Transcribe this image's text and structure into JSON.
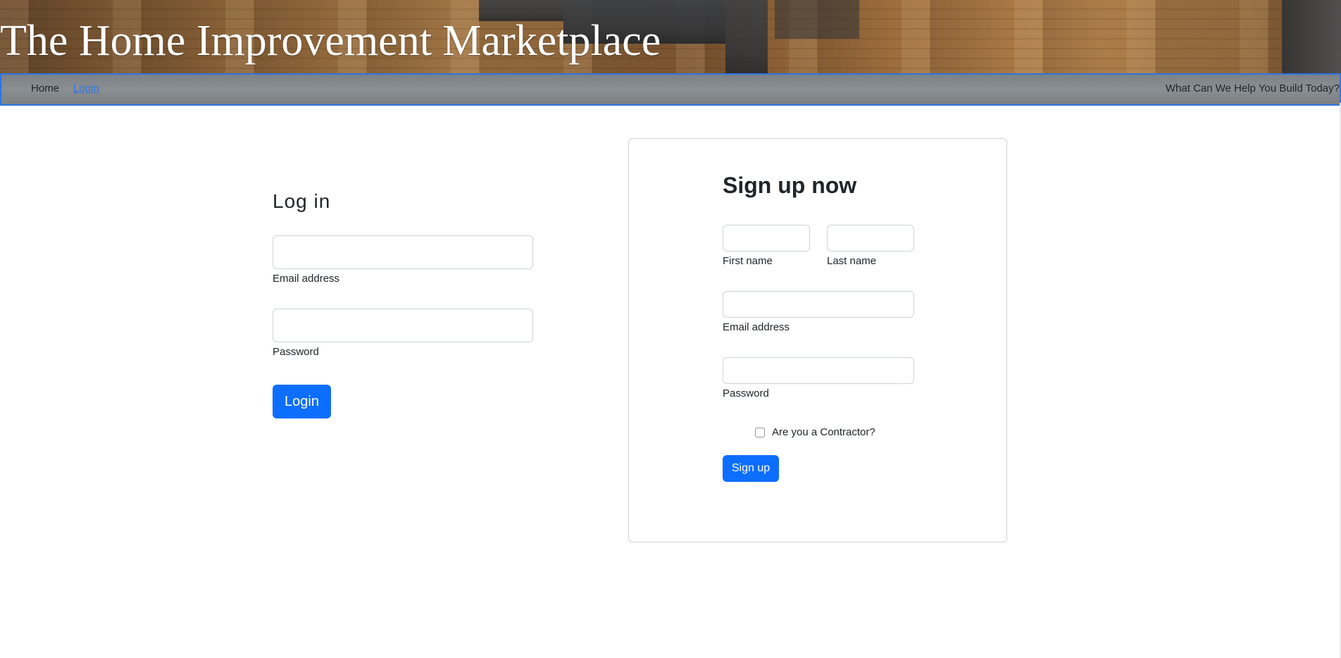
{
  "header": {
    "site_title": "The Home Improvement Marketplace"
  },
  "navbar": {
    "home_label": "Home",
    "login_label": "Login",
    "tagline": "What Can We Help You Build Today?"
  },
  "login": {
    "title": "Log in",
    "email_label": "Email address",
    "email_value": "",
    "password_label": "Password",
    "password_value": "",
    "submit_label": "Login"
  },
  "signup": {
    "title": "Sign up now",
    "first_name_label": "First name",
    "first_name_value": "",
    "last_name_label": "Last name",
    "last_name_value": "",
    "email_label": "Email address",
    "email_value": "",
    "password_label": "Password",
    "password_value": "",
    "contractor_label": "Are you a Contractor?",
    "contractor_checked": false,
    "submit_label": "Sign up"
  },
  "colors": {
    "primary": "#0d6efd",
    "navbar_border": "#2b74e6",
    "navbar_bg": "#82878b"
  }
}
